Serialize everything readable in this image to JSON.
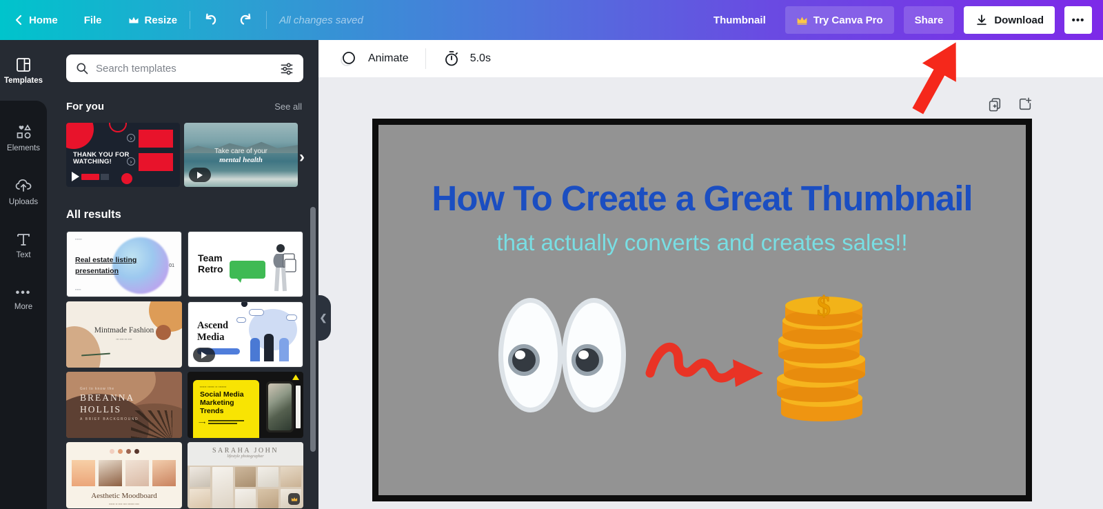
{
  "topbar": {
    "home": "Home",
    "file": "File",
    "resize": "Resize",
    "status": "All changes saved",
    "doc_title": "Thumbnail",
    "try_pro": "Try Canva Pro",
    "share": "Share",
    "download": "Download",
    "more": "•••",
    "gradient_left": "#00c4cc",
    "gradient_right": "#7d2ae8"
  },
  "sidebar": {
    "templates": "Templates",
    "elements": "Elements",
    "uploads": "Uploads",
    "text": "Text",
    "more": "More"
  },
  "panel": {
    "search_placeholder": "Search templates",
    "for_you_title": "For you",
    "see_all": "See all",
    "all_results_title": "All results",
    "for_you_items": [
      {
        "line1": "THANK YOU FOR",
        "line2": "WATCHING!"
      },
      {
        "line1": "Take care of your",
        "line2": "mental health"
      }
    ],
    "results": [
      {
        "title": "Real estate listing presentation",
        "page_num": "01"
      },
      {
        "title1": "Team",
        "title2": "Retro"
      },
      {
        "title": "Mintmade Fashion"
      },
      {
        "title1": "Ascend",
        "title2": "Media"
      },
      {
        "title1": "BREANNA",
        "title2": "HOLLIS",
        "subtitle": "A BRIEF BACKGROUND",
        "kicker": "Get to know the"
      },
      {
        "title1": "Social Media",
        "title2": "Marketing",
        "title3": "Trends"
      },
      {
        "title": "Aesthetic Moodboard"
      },
      {
        "title": "SARAHA JOHN",
        "subtitle": "lifestyle photographer"
      }
    ]
  },
  "toolbar": {
    "animate": "Animate",
    "duration": "5.0s"
  },
  "canvas": {
    "title": "How To Create a Great Thumbnail",
    "subtitle": "that actually converts and creates sales!!",
    "title_color": "#1b4ec1",
    "subtitle_color": "#79dee3",
    "page_bg": "#939393",
    "annotation_color": "#f5281b"
  }
}
